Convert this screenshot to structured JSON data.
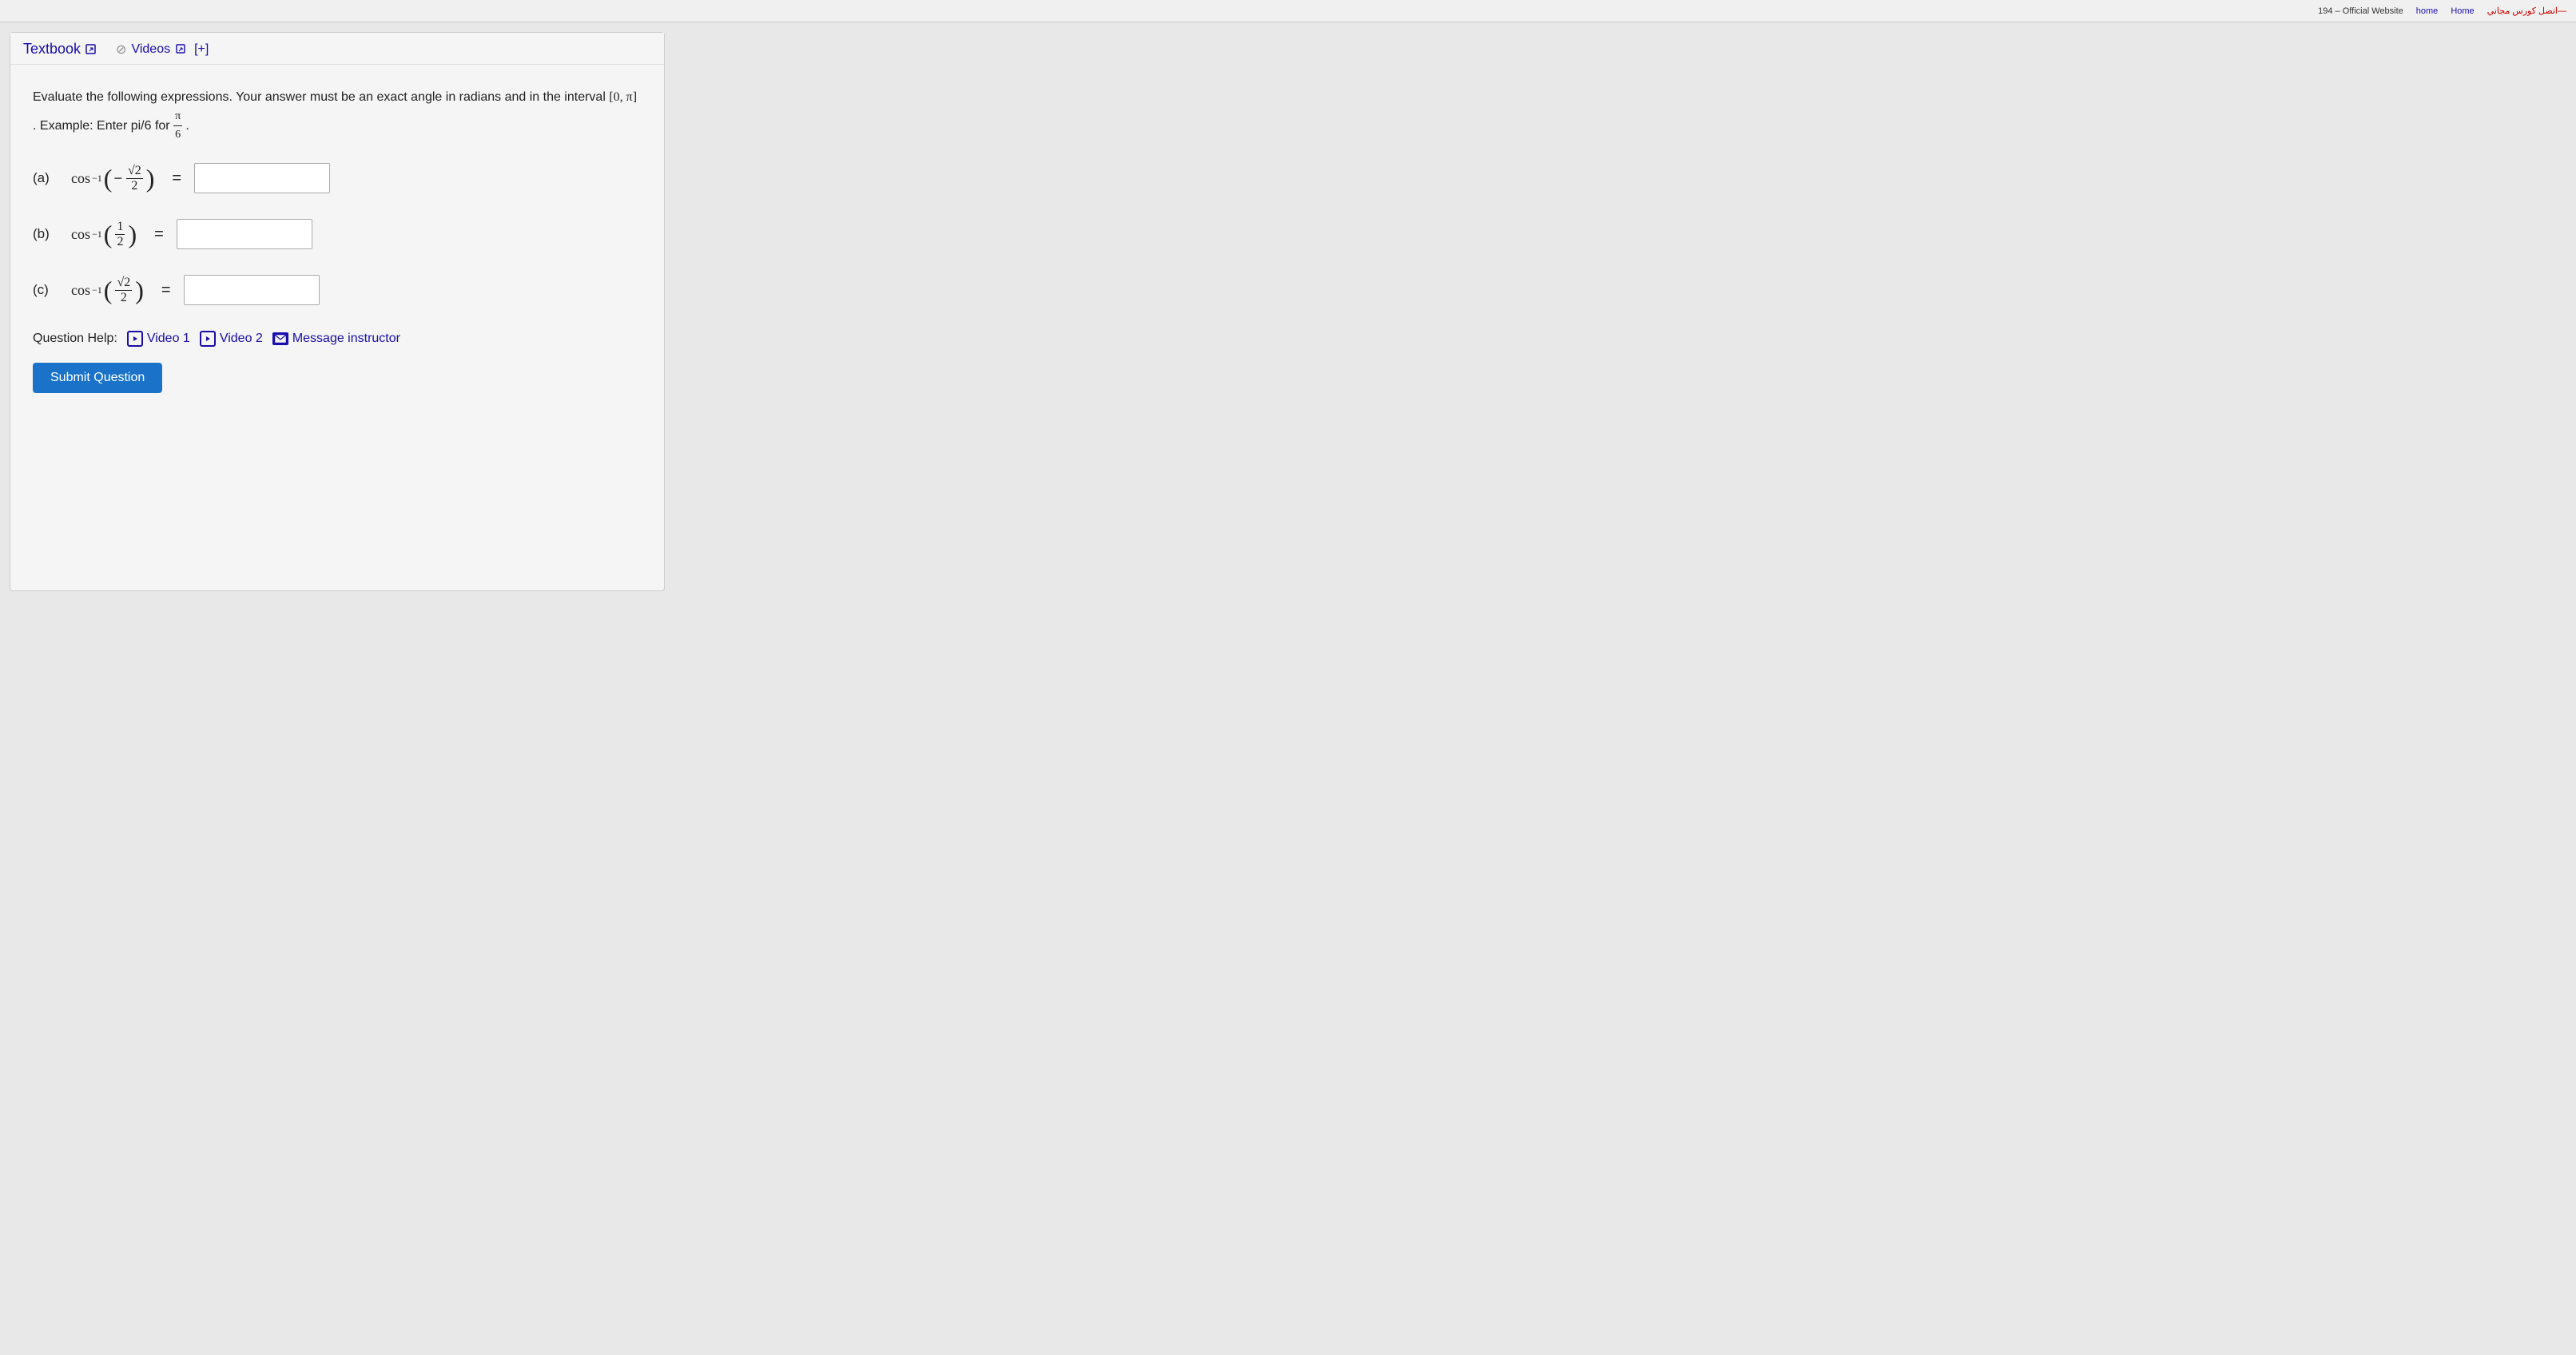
{
  "topbar": {
    "official_website": "194 – Official Website",
    "home_link": "home",
    "home_link2": "Home",
    "arabic_link": "اتصل كورس مجاني—"
  },
  "tabs": {
    "textbook_label": "Textbook",
    "videos_label": "Videos",
    "add_label": "[+]"
  },
  "instruction": {
    "line1": "Evaluate the following expressions. Your answer must be an exact angle in radians and in the interval",
    "interval": "[0, π]",
    "line2": ". Example: Enter pi/6 for",
    "fraction_num": "π",
    "fraction_den": "6",
    "fraction_suffix": "."
  },
  "parts": {
    "a": {
      "label": "(a)",
      "expr": "cos⁻¹(−√2/2) =",
      "placeholder": ""
    },
    "b": {
      "label": "(b)",
      "expr": "cos⁻¹(1/2) =",
      "placeholder": ""
    },
    "c": {
      "label": "(c)",
      "expr": "cos⁻¹(√2/2) =",
      "placeholder": ""
    }
  },
  "help": {
    "label": "Question Help:",
    "video1": "Video 1",
    "video2": "Video 2",
    "message": "Message instructor"
  },
  "submit": {
    "label": "Submit Question"
  }
}
